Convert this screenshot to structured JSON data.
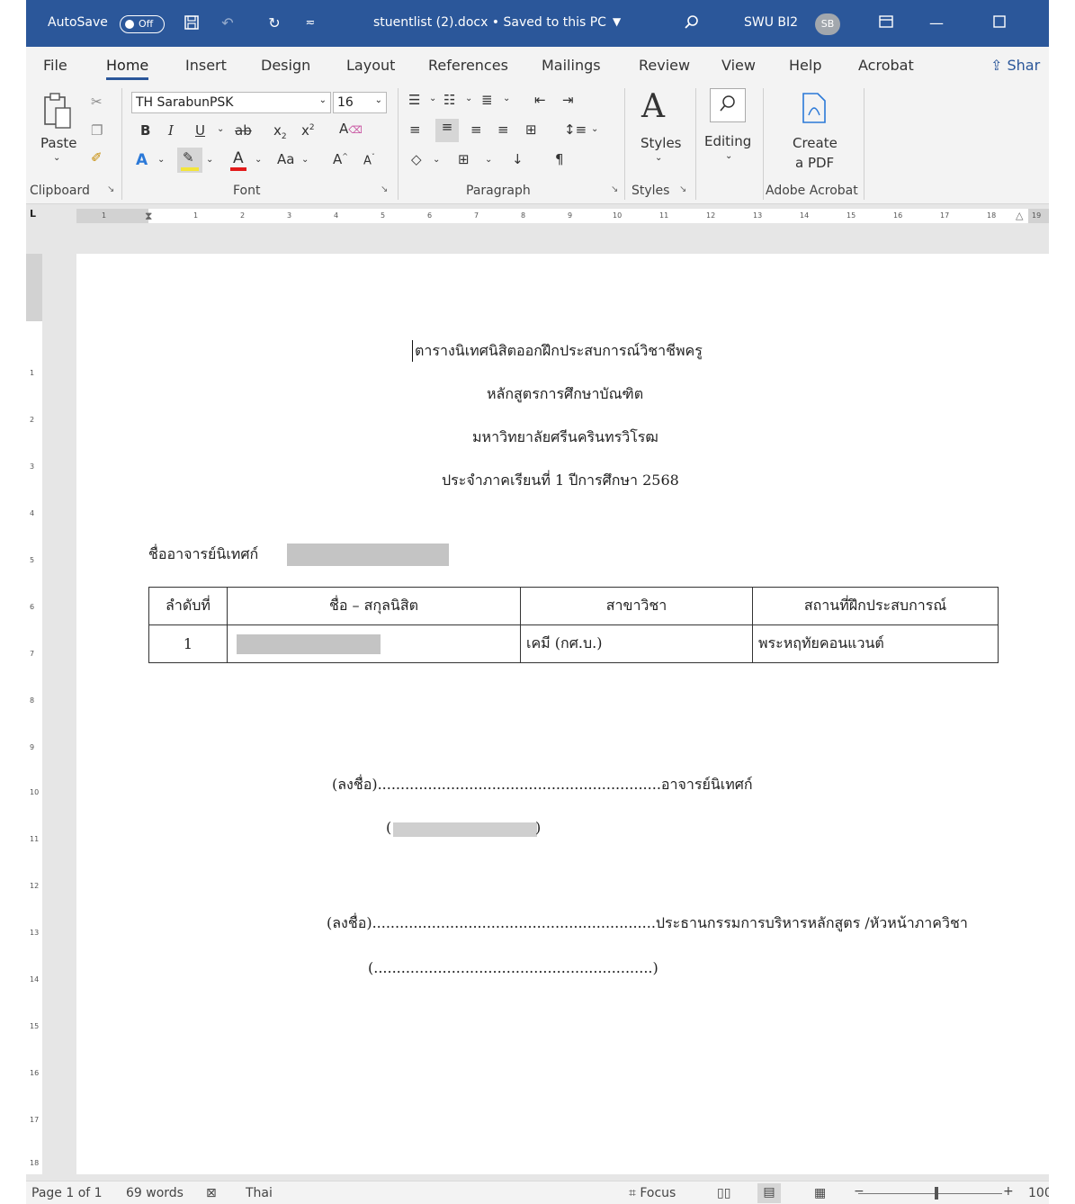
{
  "titlebar": {
    "autosave_label": "AutoSave",
    "autosave_state": "Off",
    "doc_title": "stuentlist (2).docx • Saved to this PC",
    "user_name": "SWU BI2",
    "avatar_initials": "SB"
  },
  "tabs": [
    "File",
    "Home",
    "Insert",
    "Design",
    "Layout",
    "References",
    "Mailings",
    "Review",
    "View",
    "Help",
    "Acrobat"
  ],
  "share_label": "Shar",
  "ribbon": {
    "clipboard": {
      "paste_label": "Paste",
      "group_label": "Clipboard"
    },
    "font": {
      "font_name": "TH SarabunPSK",
      "font_size": "16",
      "group_label": "Font",
      "change_case": "Aa"
    },
    "paragraph": {
      "group_label": "Paragraph"
    },
    "styles": {
      "label": "Styles",
      "group_label": "Styles"
    },
    "editing": {
      "label": "Editing"
    },
    "acrobat": {
      "create_line1": "Create",
      "create_line2": "a PDF",
      "group_label": "Adobe Acrobat"
    }
  },
  "ruler": {
    "h_ticks": [
      "1",
      "1",
      "2",
      "3",
      "4",
      "5",
      "6",
      "7",
      "8",
      "9",
      "10",
      "11",
      "12",
      "13",
      "14",
      "15",
      "16",
      "17",
      "18",
      "19"
    ],
    "v_ticks": [
      "1",
      "2",
      "3",
      "4",
      "5",
      "6",
      "7",
      "8",
      "9",
      "10",
      "11",
      "12",
      "13",
      "14",
      "15",
      "16",
      "17",
      "18"
    ]
  },
  "document": {
    "heading_lines": [
      "ตารางนิเทศนิสิตออกฝึกประสบการณ์วิชาชีพครู",
      "หลักสูตรการศึกษาบัณฑิต",
      "มหาวิทยาลัยศรีนครินทรวิโรฒ",
      "ประจำภาคเรียนที่ 1 ปีการศึกษา 2568"
    ],
    "supervisor_label": "ชื่ออาจารย์นิเทศก์",
    "table": {
      "headers": [
        "ลำดับที่",
        "ชื่อ – สกุลนิสิต",
        "สาขาวิชา",
        "สถานที่ฝึกประสบการณ์"
      ],
      "rows": [
        {
          "no": "1",
          "name": "",
          "major": "เคมี (กศ.บ.)",
          "place": "พระหฤทัยคอนแวนต์"
        }
      ]
    },
    "sign1": "(ลงชื่อ)..............................................................อาจารย์นิเทศก์",
    "sign1_paren_open": "(",
    "sign1_paren_close": ")",
    "sign2": "(ลงชื่อ)..............................................................ประธานกรรมการบริหารหลักสูตร /หัวหน้าภาควิชา",
    "sign2_name": "(.............................................................)"
  },
  "status": {
    "page": "Page 1 of 1",
    "words": "69 words",
    "language": "Thai",
    "focus": "Focus",
    "zoom": "100"
  }
}
